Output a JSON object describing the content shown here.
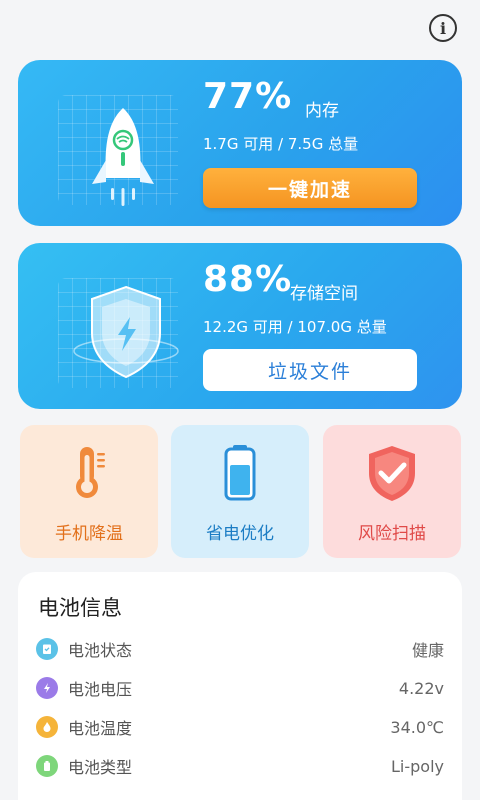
{
  "memory": {
    "percent": "77%",
    "label": "内存",
    "usage": "1.7G 可用 / 7.5G 总量",
    "button": "一键加速"
  },
  "storage": {
    "percent": "88%",
    "label": "存储空间",
    "usage": "12.2G 可用 / 107.0G 总量",
    "button": "垃圾文件"
  },
  "tiles": [
    {
      "label": "手机降温",
      "icon": "thermometer-icon"
    },
    {
      "label": "省电优化",
      "icon": "battery-icon"
    },
    {
      "label": "风险扫描",
      "icon": "shield-check-icon"
    }
  ],
  "battery_info": {
    "title": "电池信息",
    "rows": [
      {
        "label": "电池状态",
        "value": "健康",
        "icon": "clipboard-icon",
        "color": "#5bc2e7"
      },
      {
        "label": "电池电压",
        "value": "4.22v",
        "icon": "bolt-icon",
        "color": "#9b7be8"
      },
      {
        "label": "电池温度",
        "value": "34.0℃",
        "icon": "flame-icon",
        "color": "#f5b43a"
      },
      {
        "label": "电池类型",
        "value": "Li-poly",
        "icon": "battery-small-icon",
        "color": "#7ed67b"
      }
    ]
  },
  "colors": {
    "accent_orange": "#f59421",
    "card_blue": "#2aa3ec",
    "link_blue": "#2b7fd8"
  }
}
